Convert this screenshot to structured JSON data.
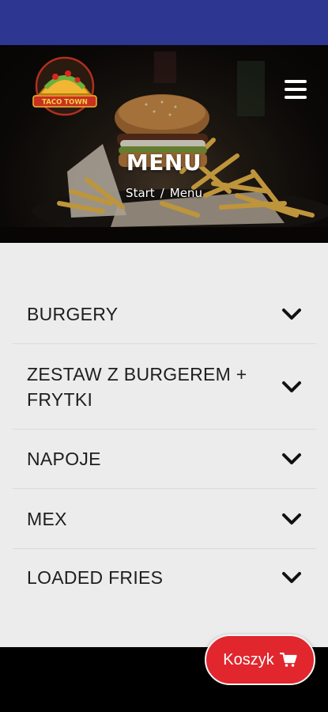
{
  "header": {
    "logo_icon": "taco-logo-icon",
    "logo_text": "TACO TOWN",
    "menu_icon": "hamburger-menu-icon",
    "title": "MENU",
    "breadcrumb": {
      "home": "Start",
      "separator": "/",
      "current": "Menu"
    }
  },
  "menu": {
    "categories": [
      {
        "label": "BURGERY",
        "icon": "chevron-down-icon"
      },
      {
        "label": "ZESTAW Z BURGEREM + FRYTKI",
        "icon": "chevron-down-icon"
      },
      {
        "label": "NAPOJE",
        "icon": "chevron-down-icon"
      },
      {
        "label": "MEX",
        "icon": "chevron-down-icon"
      },
      {
        "label": "LOADED FRIES",
        "icon": "chevron-down-icon"
      }
    ]
  },
  "cart": {
    "label": "Koszyk",
    "icon": "shopping-cart-icon"
  },
  "colors": {
    "status_bar": "#2d3691",
    "accent_red": "#e1262d",
    "content_bg": "#ececec",
    "text_dark": "#1e1e1e"
  }
}
